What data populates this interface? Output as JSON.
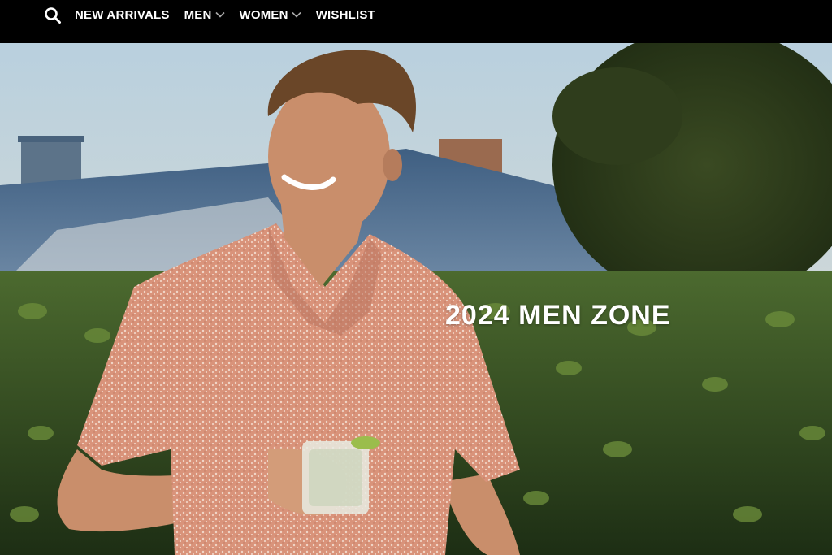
{
  "nav": {
    "search_icon": "search-icon",
    "items": [
      {
        "label": "NEW ARRIVALS",
        "has_dropdown": false
      },
      {
        "label": "MEN",
        "has_dropdown": true
      },
      {
        "label": "WOMEN",
        "has_dropdown": true
      },
      {
        "label": "WISHLIST",
        "has_dropdown": false
      }
    ]
  },
  "hero": {
    "title": "2024 MEN ZONE"
  },
  "colors": {
    "nav_bg": "#000000",
    "nav_text": "#ffffff",
    "hero_text": "#ffffff"
  }
}
